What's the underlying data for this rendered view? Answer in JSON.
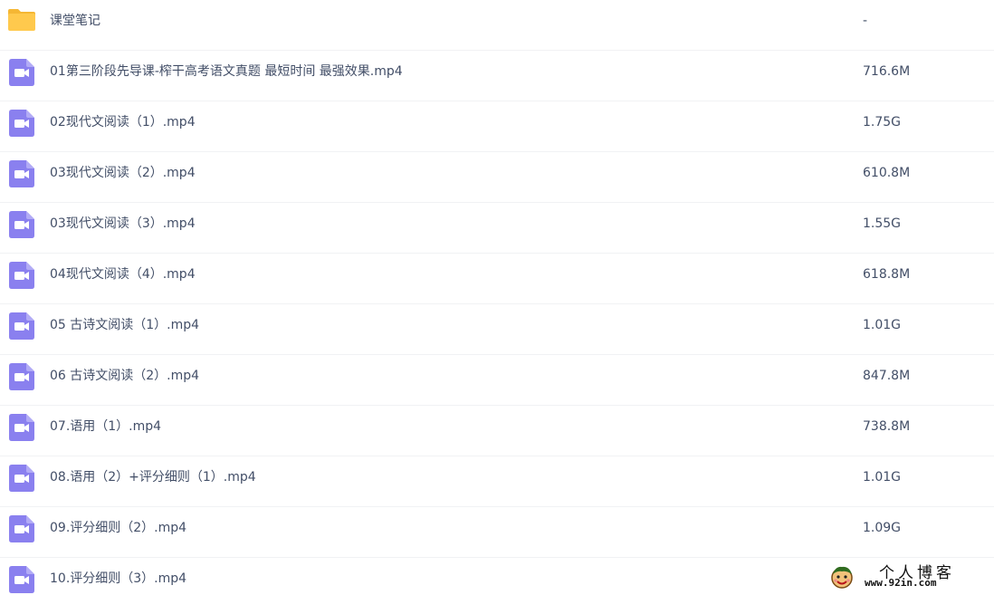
{
  "colors": {
    "folder": "#ffc94d",
    "folder_tab": "#f5b734",
    "video": "#8a80ef",
    "text": "#424e67",
    "divider": "#f1f2f4"
  },
  "files": [
    {
      "name": "课堂笔记",
      "size": "-",
      "icon": "folder-icon"
    },
    {
      "name": "01第三阶段先导课-榨干高考语文真题 最短时间 最强效果.mp4",
      "size": "716.6M",
      "icon": "video-file-icon"
    },
    {
      "name": "02现代文阅读（1）.mp4",
      "size": "1.75G",
      "icon": "video-file-icon"
    },
    {
      "name": "03现代文阅读（2）.mp4",
      "size": "610.8M",
      "icon": "video-file-icon"
    },
    {
      "name": "03现代文阅读（3）.mp4",
      "size": "1.55G",
      "icon": "video-file-icon"
    },
    {
      "name": "04现代文阅读（4）.mp4",
      "size": "618.8M",
      "icon": "video-file-icon"
    },
    {
      "name": "05 古诗文阅读（1）.mp4",
      "size": "1.01G",
      "icon": "video-file-icon"
    },
    {
      "name": "06 古诗文阅读（2）.mp4",
      "size": "847.8M",
      "icon": "video-file-icon"
    },
    {
      "name": "07.语用（1）.mp4",
      "size": "738.8M",
      "icon": "video-file-icon"
    },
    {
      "name": "08.语用（2）+评分细则（1）.mp4",
      "size": "1.01G",
      "icon": "video-file-icon"
    },
    {
      "name": "09.评分细则（2）.mp4",
      "size": "1.09G",
      "icon": "video-file-icon"
    },
    {
      "name": "10.评分细则（3）.mp4",
      "size": "",
      "icon": "video-file-icon"
    }
  ],
  "watermark": {
    "title": "个人博客",
    "url": "www.92in.com",
    "icon": "mascot-icon"
  }
}
